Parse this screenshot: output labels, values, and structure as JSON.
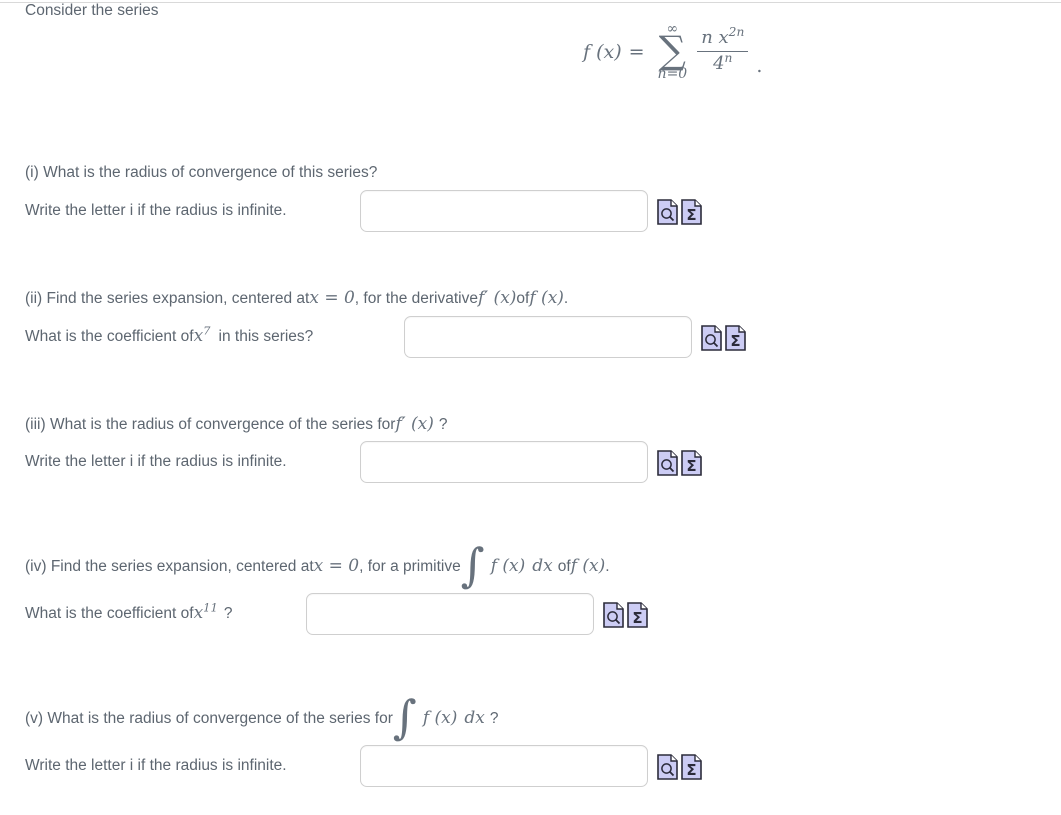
{
  "page": {
    "intro": "Consider the series",
    "equation": {
      "lhs": "f (x)",
      "equals": "=",
      "sum_upper": "∞",
      "sum_symbol": "∑",
      "sum_lower": "n=0",
      "numerator_base": "n x",
      "numerator_exponent": "2n",
      "denominator_base": "4",
      "denominator_exponent": "n",
      "trailing_period": "."
    }
  },
  "questions": [
    {
      "id": "i",
      "line1_pre": "(i) What is the radius of convergence of this series?",
      "line2_pre": "Write the letter i if the radius is infinite.",
      "input_value": "",
      "input_placeholder": ""
    },
    {
      "id": "ii",
      "line1_a": "(ii) Find the series expansion, centered at ",
      "line1_math1": "x = 0",
      "line1_b": ", for the derivative ",
      "line1_math2": "f′ (x)",
      "line1_c": " of ",
      "line1_math3": "f (x)",
      "line1_d": ".",
      "line2_a": "What is the coefficient of ",
      "line2_math_base": "x",
      "line2_math_exp": "7",
      "line2_b": "in this series?",
      "input_value": "",
      "input_placeholder": ""
    },
    {
      "id": "iii",
      "line1_a": "(iii) What is the radius of convergence of the series for ",
      "line1_math1": "f′ (x)",
      "line1_b": "?",
      "line2_pre": "Write the letter i if the radius is infinite.",
      "input_value": "",
      "input_placeholder": ""
    },
    {
      "id": "iv",
      "line1_a": "(iv) Find the series expansion, centered at ",
      "line1_math1": "x = 0",
      "line1_b": ", for a primitive ",
      "line1_int": "∫",
      "line1_math2": "f (x)",
      "line1_math3": "dx",
      "line1_c": " of ",
      "line1_math4": "f (x)",
      "line1_d": ".",
      "line2_a": "What is the coefficient of ",
      "line2_math_base": "x",
      "line2_math_exp": "11",
      "line2_b": "?",
      "input_value": "",
      "input_placeholder": ""
    },
    {
      "id": "v",
      "line1_a": "(v) What is the radius of convergence of the series for ",
      "line1_int": "∫",
      "line1_math1": "f (x)",
      "line1_math2": "dx",
      "line1_b": "?",
      "line2_pre": "Write the letter i if the radius is infinite.",
      "input_value": "",
      "input_placeholder": ""
    }
  ],
  "icons": {
    "preview_icon": "document-magnifier-icon",
    "math_icon": "document-sigma-icon",
    "sigma_glyph": "Σ",
    "fill_color": "#ccccf4",
    "stroke_color": "#2b2b3a"
  },
  "colors": {
    "text": "#5d6670",
    "math": "#68727d",
    "input_border": "#cfcfcf",
    "rule": "#d9d9d9",
    "background": "#ffffff"
  }
}
